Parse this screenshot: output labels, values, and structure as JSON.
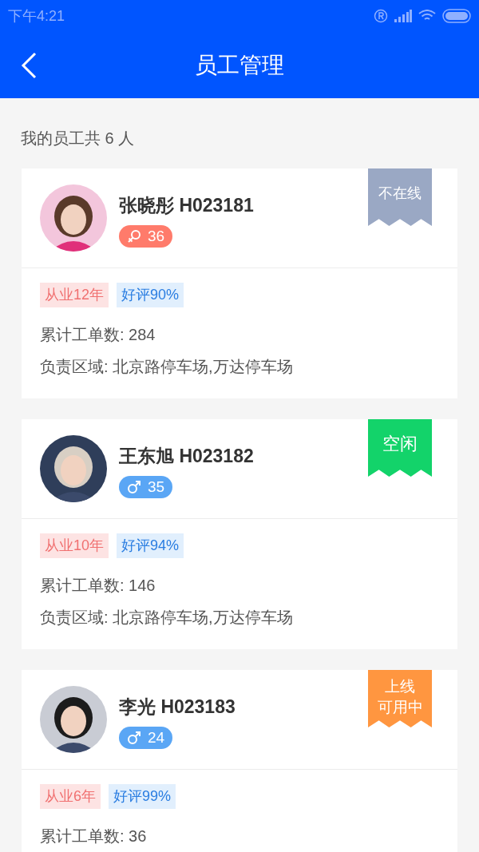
{
  "status_bar": {
    "time": "下午4:21"
  },
  "header": {
    "title": "员工管理"
  },
  "summary": "我的员工共 6 人",
  "employees": [
    {
      "name": "张晓彤 H023181",
      "badge": {
        "kind": "female",
        "age": "36"
      },
      "status": {
        "kind": "offline",
        "lines": [
          "不在线"
        ]
      },
      "tags": [
        {
          "text": "从业12年",
          "kind": "experience"
        },
        {
          "text": "好评90%",
          "kind": "rating"
        }
      ],
      "orders": "累计工单数: 284",
      "area": "负责区域: 北京路停车场,万达停车场"
    },
    {
      "name": "王东旭 H023182",
      "badge": {
        "kind": "male",
        "age": "35"
      },
      "status": {
        "kind": "idle",
        "lines": [
          "空闲"
        ]
      },
      "tags": [
        {
          "text": "从业10年",
          "kind": "experience"
        },
        {
          "text": "好评94%",
          "kind": "rating"
        }
      ],
      "orders": "累计工单数: 146",
      "area": "负责区域: 北京路停车场,万达停车场"
    },
    {
      "name": "李光 H023183",
      "badge": {
        "kind": "male",
        "age": "24"
      },
      "status": {
        "kind": "online",
        "lines": [
          "上线",
          "可用中"
        ]
      },
      "tags": [
        {
          "text": "从业6年",
          "kind": "experience"
        },
        {
          "text": "好评99%",
          "kind": "rating"
        }
      ],
      "orders": "累计工单数: 36"
    }
  ]
}
